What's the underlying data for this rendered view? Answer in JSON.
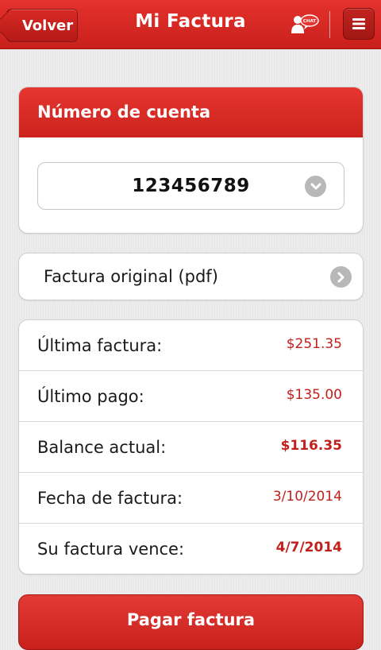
{
  "header": {
    "back_label": "Volver",
    "title": "Mi Factura",
    "chat_icon_text": "CHAT"
  },
  "account": {
    "heading": "Número de cuenta",
    "selected_value": "123456789"
  },
  "pdf": {
    "label": "Factura original (pdf)"
  },
  "summary": {
    "rows": [
      {
        "label": "Última factura:",
        "value": "$251.35"
      },
      {
        "label": "Último pago:",
        "value": "$135.00"
      },
      {
        "label": "Balance actual:",
        "value": "$116.35"
      },
      {
        "label": "Fecha de factura:",
        "value": "3/10/2014"
      },
      {
        "label": "Su factura vence:",
        "value": "4/7/2014"
      }
    ]
  },
  "actions": {
    "pay_label": "Pagar factura"
  },
  "colors": {
    "brand_red": "#d42a24",
    "value_red": "#c1201c",
    "icon_gray": "#b8b8b8"
  }
}
